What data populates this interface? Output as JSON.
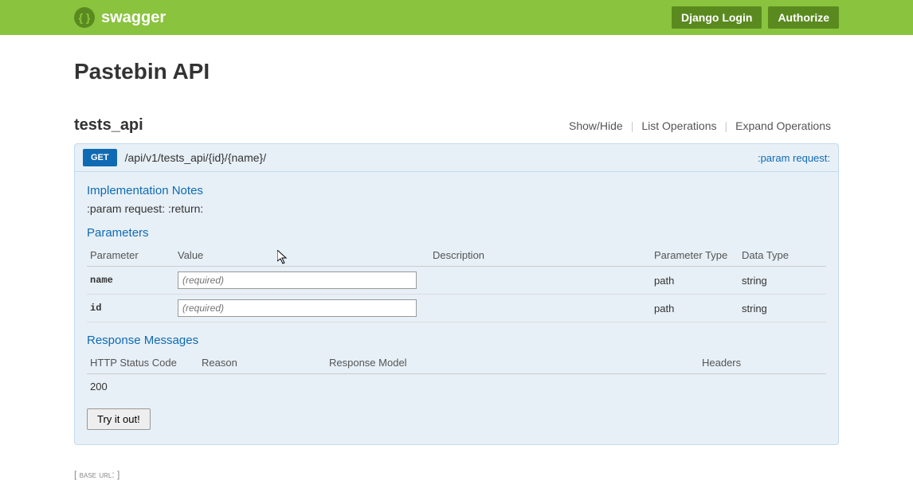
{
  "header": {
    "brand": "swagger",
    "login_label": "Django Login",
    "authorize_label": "Authorize"
  },
  "api": {
    "title": "Pastebin API"
  },
  "resource": {
    "name": "tests_api",
    "actions": {
      "showhide": "Show/Hide",
      "list_ops": "List Operations",
      "expand_ops": "Expand Operations"
    }
  },
  "operation": {
    "method": "GET",
    "path": "/api/v1/tests_api/{id}/{name}/",
    "summary": ":param request:",
    "notes_title": "Implementation Notes",
    "notes_text": ":param request: :return:",
    "params_title": "Parameters",
    "params_headers": {
      "parameter": "Parameter",
      "value": "Value",
      "description": "Description",
      "parameter_type": "Parameter Type",
      "data_type": "Data Type"
    },
    "params": [
      {
        "name": "name",
        "placeholder": "(required)",
        "description": "",
        "param_type": "path",
        "data_type": "string"
      },
      {
        "name": "id",
        "placeholder": "(required)",
        "description": "",
        "param_type": "path",
        "data_type": "string"
      }
    ],
    "resp_title": "Response Messages",
    "resp_headers": {
      "status": "HTTP Status Code",
      "reason": "Reason",
      "model": "Response Model",
      "headers": "Headers"
    },
    "responses": [
      {
        "status": "200",
        "reason": "",
        "model": "",
        "headers": ""
      }
    ],
    "try_label": "Try it out!"
  },
  "footer": {
    "base_url_label": "[ base url: ]"
  }
}
